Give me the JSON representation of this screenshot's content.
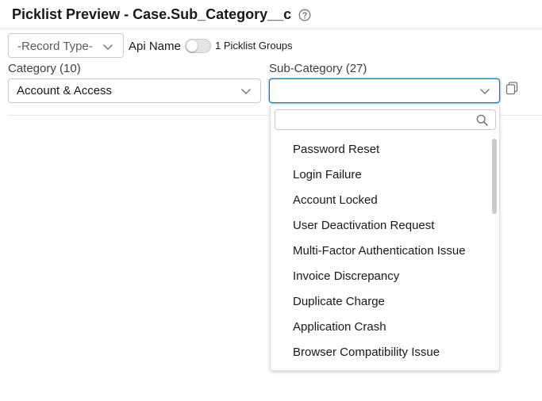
{
  "header": {
    "title": "Picklist Preview - Case.Sub_Category__c"
  },
  "controls": {
    "record_type_value": "-Record Type-",
    "api_name_label": "Api Name",
    "api_name_toggle_on": false,
    "picklist_groups_label": "1 Picklist Groups"
  },
  "category": {
    "label": "Category (10)",
    "value": "Account & Access"
  },
  "sub_category": {
    "label": "Sub-Category (27)",
    "value": "",
    "search_value": "",
    "options": [
      "Password Reset",
      "Login Failure",
      "Account Locked",
      "User Deactivation Request",
      "Multi-Factor Authentication Issue",
      "Invoice Discrepancy",
      "Duplicate Charge",
      "Application Crash",
      "Browser Compatibility Issue"
    ]
  },
  "icons": {
    "help": "help-icon",
    "chevron": "chevron-down-icon",
    "copy": "copy-icon",
    "search": "search-icon"
  },
  "colors": {
    "focus_border": "#0176d3",
    "border": "#c9c9c9",
    "text": "#181818"
  }
}
